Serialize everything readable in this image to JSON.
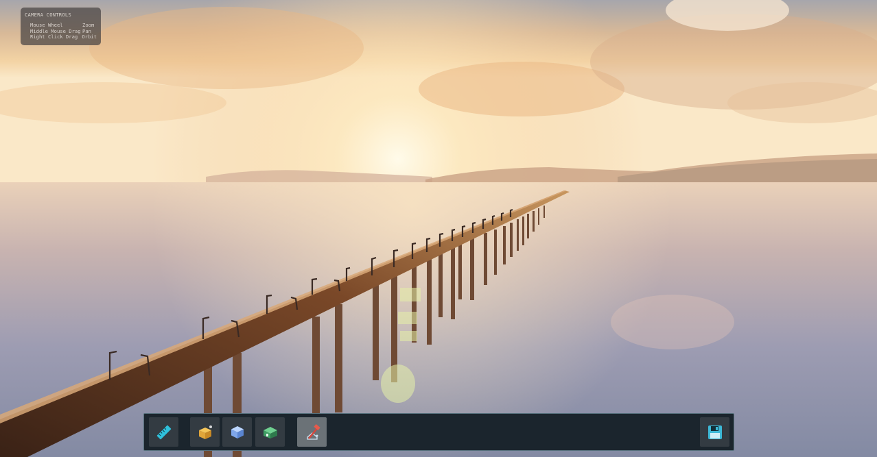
{
  "camera_controls": {
    "title": "CAMERA CONTROLS",
    "rows": [
      {
        "action": "Mouse Wheel",
        "effect": "Zoom"
      },
      {
        "action": "Middle Mouse Drag",
        "effect": "Pan"
      },
      {
        "action": "Right Click Drag",
        "effect": "Orbit"
      }
    ]
  },
  "toolbar": {
    "tools": [
      {
        "icon": "ruler-icon",
        "active": false
      },
      {
        "icon": "box-package-icon",
        "active": false
      },
      {
        "icon": "cube-icon",
        "active": false
      },
      {
        "icon": "house-icon",
        "active": false
      },
      {
        "icon": "demolish-hammer-icon",
        "active": true
      }
    ],
    "save_icon": "floppy-disk-icon"
  },
  "colors": {
    "toolbar_bg": "#1b252d",
    "toolbar_border": "#56707c",
    "ruler": "#2fc1dc",
    "save": "#3db8d6"
  }
}
